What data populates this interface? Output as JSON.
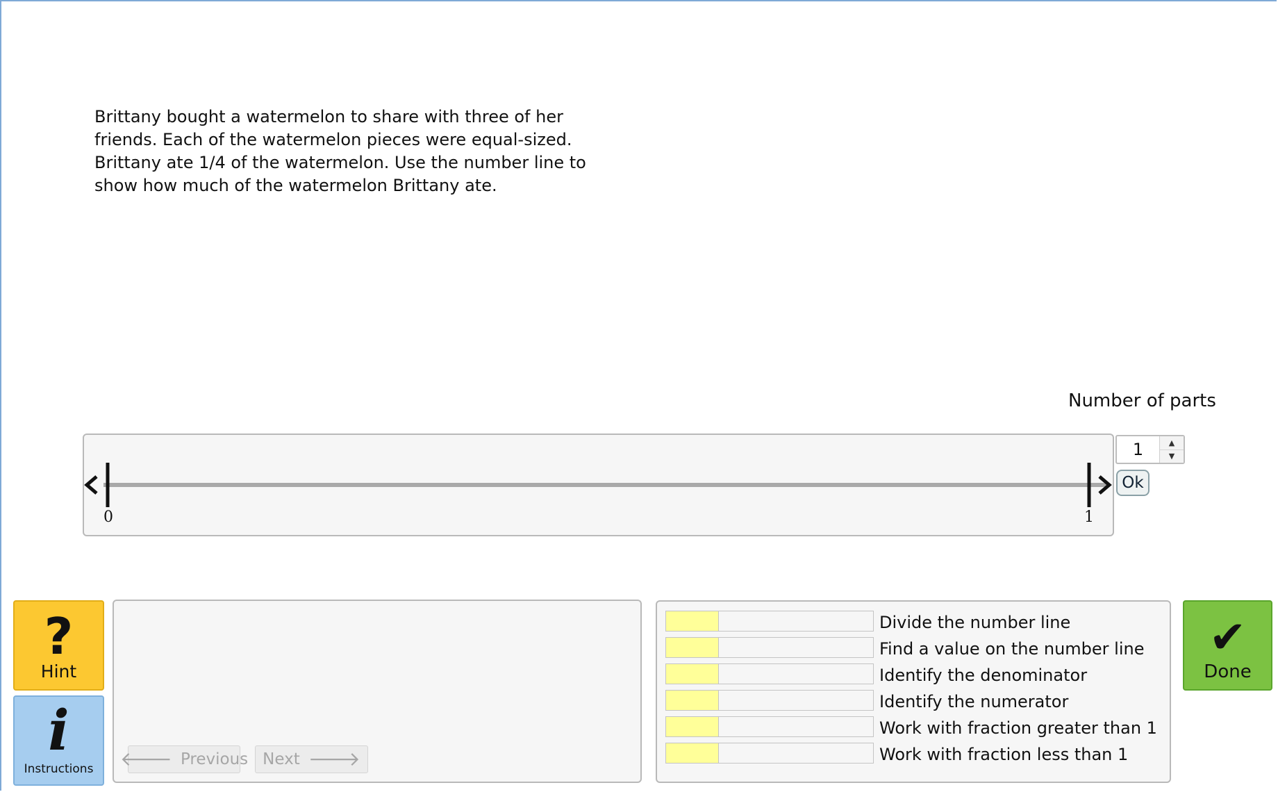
{
  "problem": {
    "lines": [
      "Brittany bought a watermelon to share with three of her",
      "friends. Each of the watermelon pieces were equal-sized.",
      "Brittany ate 1/4 of the watermelon. Use the number line to",
      "show how much of the watermelon Brittany ate."
    ]
  },
  "number_line": {
    "parts_label": "Number of parts",
    "parts_value": "1",
    "ok_label": "Ok",
    "start_label": "0",
    "end_label": "1"
  },
  "hint": {
    "label": "Hint",
    "glyph": "?"
  },
  "instructions": {
    "label": "Instructions",
    "glyph": "i"
  },
  "nav": {
    "previous_label": "Previous",
    "next_label": "Next"
  },
  "skills": [
    {
      "label": "Divide the number line",
      "progress": 0.25
    },
    {
      "label": "Find a value on the number line",
      "progress": 0.25
    },
    {
      "label": "Identify the denominator",
      "progress": 0.25
    },
    {
      "label": "Identify the numerator",
      "progress": 0.25
    },
    {
      "label": "Work with fraction greater than 1",
      "progress": 0.25
    },
    {
      "label": "Work with fraction less than 1",
      "progress": 0.25
    }
  ],
  "done": {
    "label": "Done",
    "glyph": "✔"
  },
  "colors": {
    "hint_bg": "#fcc831",
    "instructions_bg": "#a6cdef",
    "done_bg": "#7cc242",
    "skill_fill": "#ffff99"
  }
}
